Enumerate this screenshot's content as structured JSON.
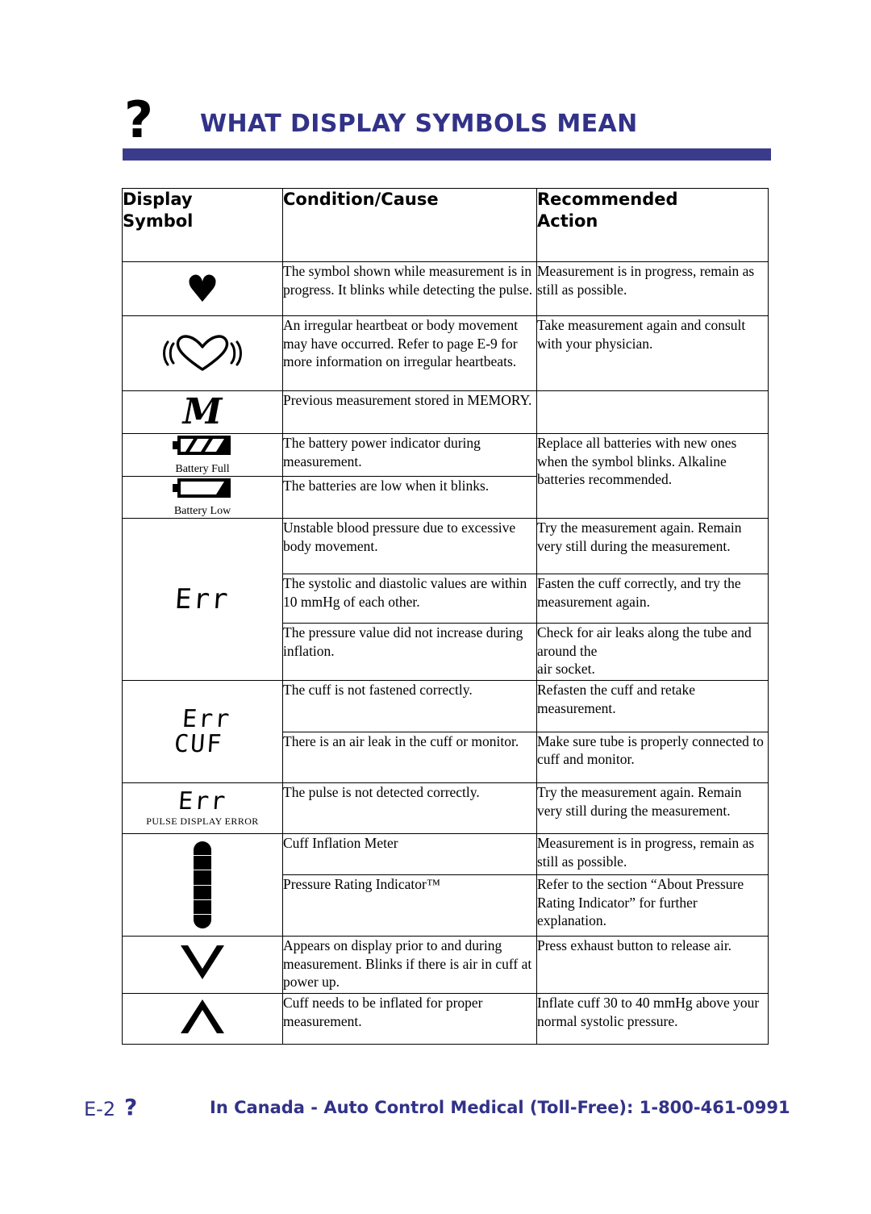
{
  "header": {
    "icon": "question-mark-icon",
    "title": "WHAT DISPLAY SYMBOLS MEAN",
    "rule_color": "#3b3b8c",
    "title_color": "#323288"
  },
  "table": {
    "columns": [
      {
        "label": "Display\nSymbol",
        "line1": "Display",
        "line2": "Symbol"
      },
      {
        "label": "Condition/Cause",
        "line1": "Condition/Cause",
        "line2": ""
      },
      {
        "label": "Recommended\nAction",
        "line1": "Recommended",
        "line2": "Action"
      }
    ],
    "rows": [
      {
        "symbol": "solid-heart-icon",
        "symbol_glyph": "♥",
        "caption": "",
        "condition": "The symbol shown while measurement is in progress. It blinks while detecting the pulse.",
        "action": "Measurement is in progress, remain as still as possible."
      },
      {
        "symbol": "irregular-heartbeat-icon",
        "symbol_glyph": "",
        "caption": "",
        "condition": "An irregular heartbeat or body movement may have occurred. Refer to page E-9 for more information on irregular heartbeats.",
        "action": "Take measurement again and consult with your physician."
      },
      {
        "symbol": "memory-m-icon",
        "symbol_glyph": "M",
        "caption": "",
        "condition": "Previous measurement stored in MEMORY.",
        "action": ""
      },
      {
        "symbol": "battery-full-icon",
        "symbol_glyph": "",
        "caption": "Battery Full",
        "condition": "The battery power indicator during measurement.",
        "action": "Replace all batteries with new ones when the symbol blinks. Alkaline batteries recommended."
      },
      {
        "symbol": "battery-low-icon",
        "symbol_glyph": "",
        "caption": "Battery Low",
        "condition": "The batteries are low when it blinks.",
        "action": ""
      },
      {
        "symbol": "err-lcd-icon",
        "symbol_glyph": "Err",
        "caption": "",
        "condition": "Unstable blood pressure due to excessive body movement.",
        "action": "Try the measurement again. Remain very still during the measurement."
      },
      {
        "symbol": "err-lcd-icon",
        "symbol_glyph": "Err",
        "caption": "",
        "condition": "The systolic and diastolic values are within 10 mmHg of each other.",
        "action": "Fasten the cuff correctly, and try the measurement again."
      },
      {
        "symbol": "err-lcd-icon",
        "symbol_glyph": "Err",
        "caption": "",
        "condition": "The pressure value did not increase during inflation.",
        "action": "Check for air leaks along the tube and around the\nair socket."
      },
      {
        "symbol": "err-cuf-lcd-icon",
        "symbol_glyph": "Err CUF",
        "caption": "",
        "condition": "The cuff is not fastened correctly.",
        "action": "Refasten the cuff and retake measurement."
      },
      {
        "symbol": "err-cuf-lcd-icon",
        "symbol_glyph": "Err CUF",
        "caption": "",
        "condition": "There is an air leak in the cuff or monitor.",
        "action": "Make sure tube is properly connected to cuff and monitor."
      },
      {
        "symbol": "err-pulse-lcd-icon",
        "symbol_glyph": "Err",
        "caption": "PULSE DISPLAY ERROR",
        "condition": "The pulse is not detected correctly.",
        "action": "Try the measurement again. Remain very still during the measurement."
      },
      {
        "symbol": "cuff-inflation-meter-icon",
        "symbol_glyph": "",
        "caption": "",
        "condition": "Cuff Inflation Meter",
        "action": "Measurement is in progress, remain as still as possible."
      },
      {
        "symbol": "cuff-inflation-meter-icon",
        "symbol_glyph": "",
        "caption": "",
        "condition": "Pressure Rating Indicator™",
        "action": "Refer to the section “About Pressure Rating Indicator” for further explanation."
      },
      {
        "symbol": "chevron-down-icon",
        "symbol_glyph": "∨",
        "caption": "",
        "condition": "Appears on display prior to and during measurement. Blinks if there is air in cuff at power up.",
        "action": "Press exhaust button to release air."
      },
      {
        "symbol": "chevron-up-icon",
        "symbol_glyph": "∧",
        "caption": "",
        "condition": "Cuff needs to be inflated for proper measurement.",
        "action": "Inflate cuff 30 to 40 mmHg above your normal systolic pressure."
      }
    ]
  },
  "footer": {
    "page_number": "E-2",
    "icon": "question-mark-icon",
    "text": "In Canada - Auto Control Medical (Toll-Free): 1-800-461-0991",
    "color": "#323288"
  }
}
